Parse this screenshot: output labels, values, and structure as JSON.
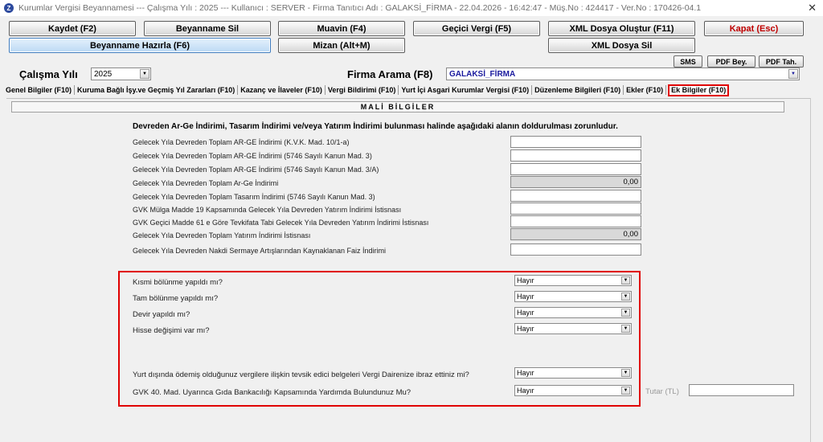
{
  "window": {
    "title": "Kurumlar Vergisi Beyannamesi   ---   Çalışma Yılı : 2025   ---   Kullanıcı : SERVER - Firma Tanıtıcı Adı : GALAKSİ_FİRMA  - 22.04.2026 - 16:42:47  - Müş.No : 424417  - Ver.No : 170426-04.1",
    "close": "✕"
  },
  "toolbar": {
    "kaydet": "Kaydet (F2)",
    "beyanname_sil": "Beyanname Sil",
    "muavin": "Muavin (F4)",
    "gecici_vergi": "Geçici Vergi (F5)",
    "xml_olustur": "XML Dosya Oluştur (F11)",
    "kapat": "Kapat (Esc)",
    "beyanname_hazirla": "Beyanname Hazırla (F6)",
    "mizan": "Mizan (Alt+M)",
    "xml_sil": "XML Dosya Sil",
    "sms": "SMS",
    "pdf_bey": "PDF Bey.",
    "pdf_tah": "PDF Tah."
  },
  "filters": {
    "year_label": "Çalışma Yılı",
    "year_value": "2025",
    "firma_label": "Firma Arama (F8)",
    "firma_value": "GALAKSİ_FİRMA"
  },
  "tabs": [
    "Genel Bilgiler (F10)",
    "Kuruma Bağlı İşy.ve Geçmiş Yıl Zararları (F10)",
    "Kazanç ve İlaveler (F10)",
    "Vergi Bildirimi (F10)",
    "Yurt İçi Asgari Kurumlar Vergisi (F10)",
    "Düzenleme Bilgileri (F10)",
    "Ekler (F10)",
    "Ek Bilgiler (F10)"
  ],
  "section_title": "MALİ BİLGİLER",
  "note": "Devreden Ar-Ge İndirimi, Tasarım İndirimi ve/veya Yatırım İndirimi bulunması halinde aşağıdaki alanın doldurulması zorunludur.",
  "rows": [
    {
      "label": "Gelecek Yıla Devreden Toplam AR-GE İndirimi (K.V.K. Mad. 10/1-a)",
      "value": ""
    },
    {
      "label": "Gelecek Yıla Devreden Toplam AR-GE İndirimi (5746 Sayılı Kanun Mad. 3)",
      "value": ""
    },
    {
      "label": "Gelecek Yıla Devreden Toplam AR-GE İndirimi (5746 Sayılı Kanun Mad. 3/A)",
      "value": ""
    },
    {
      "label": "Gelecek Yıla Devreden Toplam Ar-Ge İndirimi",
      "value": "0,00"
    },
    {
      "label": "Gelecek Yıla Devreden Toplam Tasarım İndirimi (5746 Sayılı Kanun Mad. 3)",
      "value": ""
    },
    {
      "label": "GVK Mülga Madde 19 Kapsamında Gelecek Yıla Devreden Yatırım İndirimi İstisnası",
      "value": ""
    },
    {
      "label": "GVK Geçici Madde 61 e Göre Tevkifata Tabi Gelecek Yıla Devreden Yatırım İndirimi İstisnası",
      "value": ""
    },
    {
      "label": "Gelecek Yıla Devreden Toplam Yatırım İndirimi İstisnası",
      "value": "0,00"
    },
    {
      "label": "Gelecek Yıla Devreden Nakdi Sermaye Artışlarından Kaynaklanan Faiz İndirimi",
      "value": ""
    }
  ],
  "questions": [
    {
      "label": "Kısmi bölünme yapıldı mı?",
      "value": "Hayır"
    },
    {
      "label": "Tam bölünme yapıldı mı?",
      "value": "Hayır"
    },
    {
      "label": "Devir yapıldı mı?",
      "value": "Hayır"
    },
    {
      "label": "Hisse değişimi var mı?",
      "value": "Hayır"
    },
    {
      "label": "Yurt dışında ödemiş olduğunuz vergilere ilişkin tevsik edici belgeleri Vergi Dairenize ibraz ettiniz mi?",
      "value": "Hayır"
    },
    {
      "label": "GVK 40. Mad. Uyarınca Gıda Bankacılığı Kapsamında Yardımda Bulundunuz Mu?",
      "value": "Hayır"
    }
  ],
  "tutar_label": "Tutar (TL)",
  "colors": {
    "highlight": "#e00000",
    "firma_text": "#1a1a9e",
    "kapat_text": "#c00000"
  }
}
